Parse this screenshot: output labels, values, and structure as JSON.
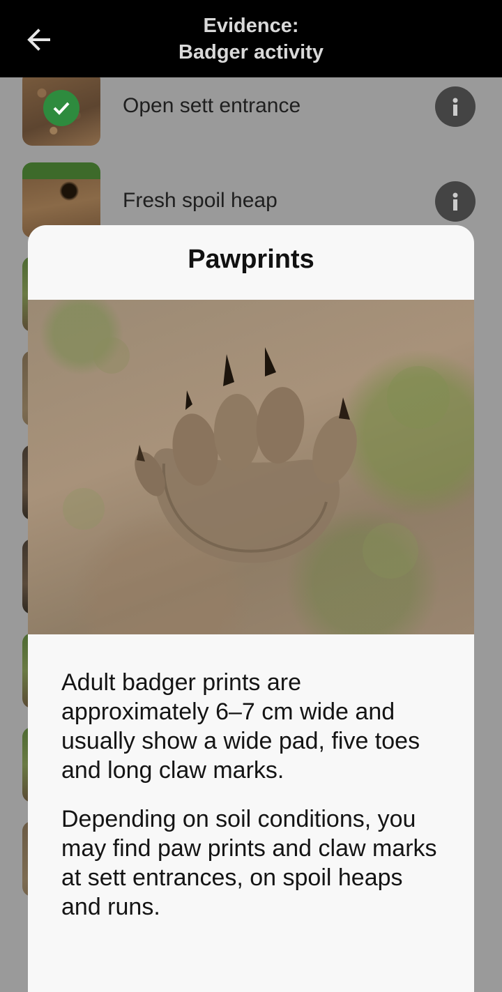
{
  "appbar": {
    "title_line1": "Evidence:",
    "title_line2": "Badger activity",
    "back_icon": "arrow-left-icon"
  },
  "list": {
    "items": [
      {
        "label": "Open sett entrance",
        "checked": true,
        "icon": "info-icon"
      },
      {
        "label": "Fresh spoil heap",
        "checked": false,
        "icon": "info-icon"
      }
    ]
  },
  "dialog": {
    "title": "Pawprints",
    "paragraphs": [
      "Adult badger prints are approximately 6–7 cm wide and usually show a wide pad, five toes and long claw marks.",
      "Depending on soil conditions, you may find paw prints and claw marks at sett entrances, on spoil heaps and runs."
    ]
  },
  "colors": {
    "appbar_bg": "#000000",
    "check_green": "#2e8b3e",
    "info_button": "#444444",
    "scrim": "#9a9a9a",
    "dialog_bg": "#f8f8f8"
  }
}
